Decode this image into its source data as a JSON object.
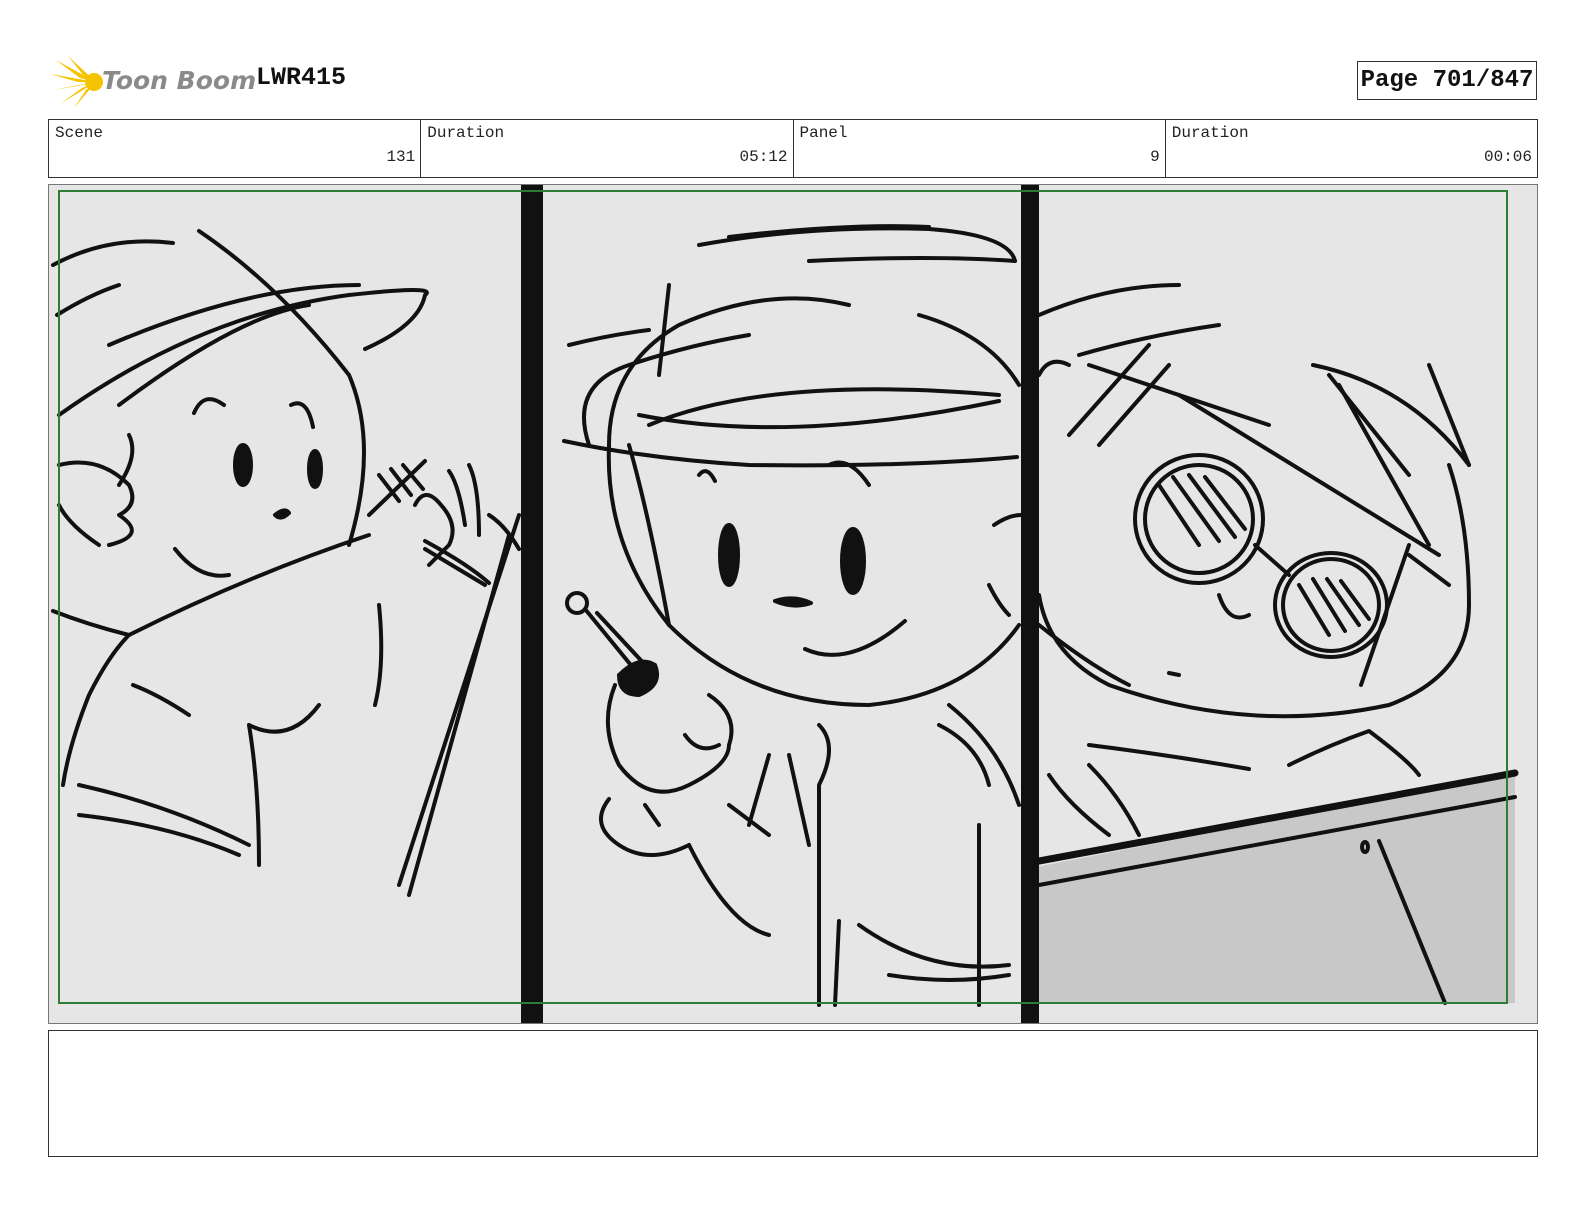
{
  "header": {
    "logo_text": "Toon Boom",
    "project_title": "LWR415",
    "page_label": "Page 701/847"
  },
  "info": {
    "scene_label": "Scene",
    "scene_value": "131",
    "duration_label": "Duration",
    "duration_value": "05:12",
    "panel_label": "Panel",
    "panel_value": "9",
    "panel_duration_label": "Duration",
    "panel_duration_value": "00:06"
  },
  "storyboard": {
    "icon": "storyboard-sketch",
    "frame_border_color": "#2e7d32",
    "background_color": "#e6e6e6",
    "shadow_color": "#c8c8c8"
  },
  "logo": {
    "icon": "starburst-icon",
    "color": "#f5c400"
  },
  "caption": {
    "text": ""
  }
}
